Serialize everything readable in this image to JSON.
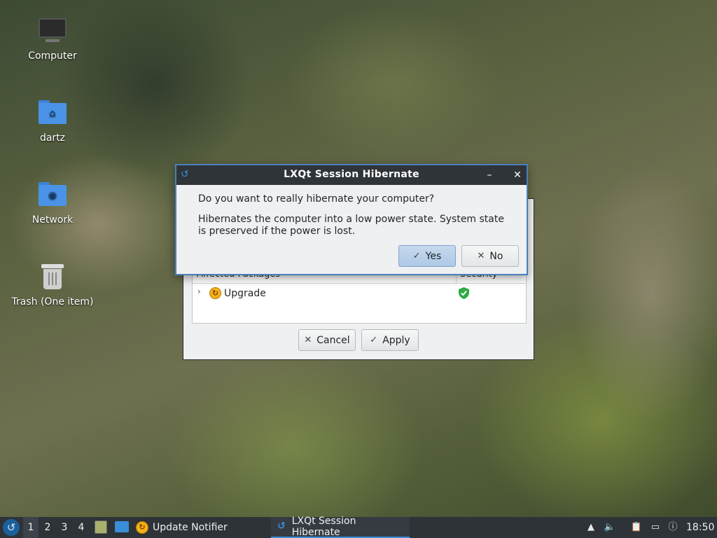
{
  "desktop": {
    "icons": [
      {
        "label": "Computer"
      },
      {
        "label": "dartz"
      },
      {
        "label": "Network"
      },
      {
        "label": "Trash (One item)"
      }
    ]
  },
  "background_window": {
    "table": {
      "columns": [
        "Affected Packages",
        "Security"
      ],
      "rows": [
        {
          "expander": "›",
          "name": "Upgrade",
          "security_icon": "green-shield-check-icon"
        }
      ]
    },
    "cancel_label": "Cancel",
    "apply_label": "Apply"
  },
  "dialog": {
    "title": "LXQt Session Hibernate",
    "question": "Do you want to really hibernate your computer?",
    "description": "Hibernates the computer into a low power state. System state is preserved if the power is lost.",
    "yes_label": "Yes",
    "no_label": "No",
    "minimize_glyph": "–",
    "close_glyph": "✕"
  },
  "taskbar": {
    "desktops": [
      "1",
      "2",
      "3",
      "4"
    ],
    "active_desktop": "1",
    "tasks": [
      {
        "label": "Update Notifier",
        "icon": "update-notifier-icon"
      },
      {
        "label": "LXQt Session Hibernate",
        "icon": "lxqt-icon",
        "active": true
      }
    ],
    "clock": "18:50"
  },
  "colors": {
    "accent": "#3a8ed8",
    "titlebar": "#2f3439",
    "dialog_border": "#4a80bd",
    "taskbar": "#2e3338"
  }
}
